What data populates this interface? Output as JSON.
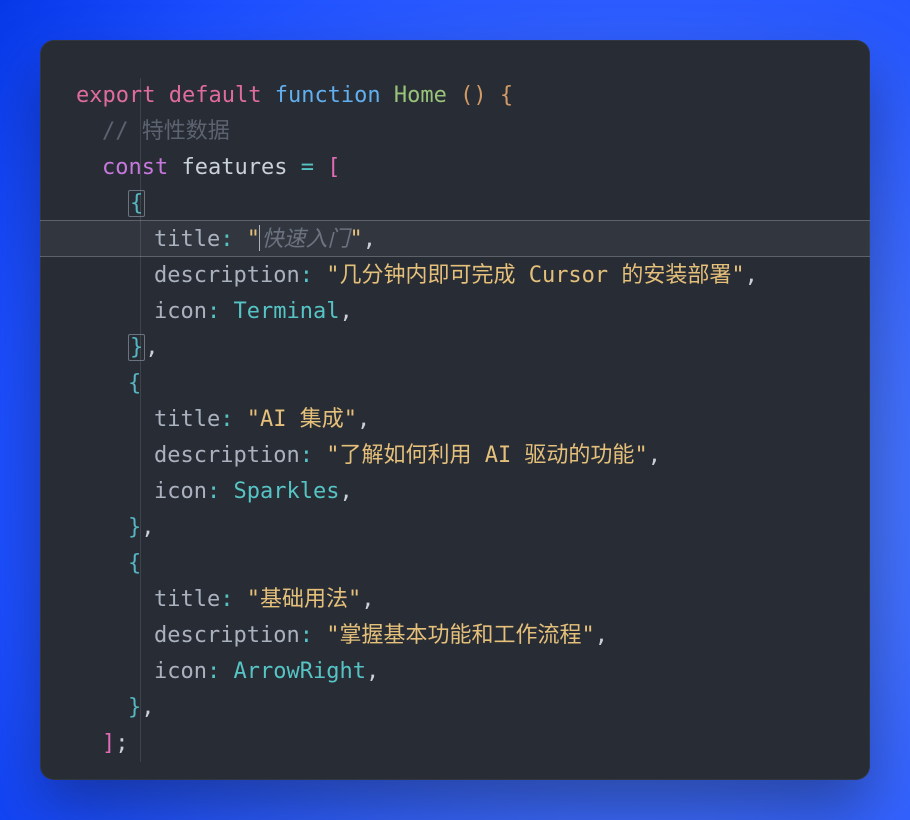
{
  "tokens": {
    "export": "export",
    "default": "default",
    "function": "function",
    "home": "Home",
    "parens": "()",
    "lbrace": "{",
    "rbrace": "}",
    "lbracket": "[",
    "rbracket": "]",
    "semi": ";",
    "const": "const",
    "features": "features",
    "eq": "=",
    "comment": "// 特性数据",
    "title": "title",
    "description": "description",
    "icon": "icon",
    "colon": ":",
    "comma": ",",
    "quote": "\"",
    "cursor_suggestion": "快速入门"
  },
  "feature_items": [
    {
      "title": "",
      "description": "几分钟内即可完成 Cursor 的安装部署",
      "icon": "Terminal"
    },
    {
      "title": "AI 集成",
      "description": "了解如何利用 AI 驱动的功能",
      "icon": "Sparkles"
    },
    {
      "title": "基础用法",
      "description": "掌握基本功能和工作流程",
      "icon": "ArrowRight"
    }
  ]
}
